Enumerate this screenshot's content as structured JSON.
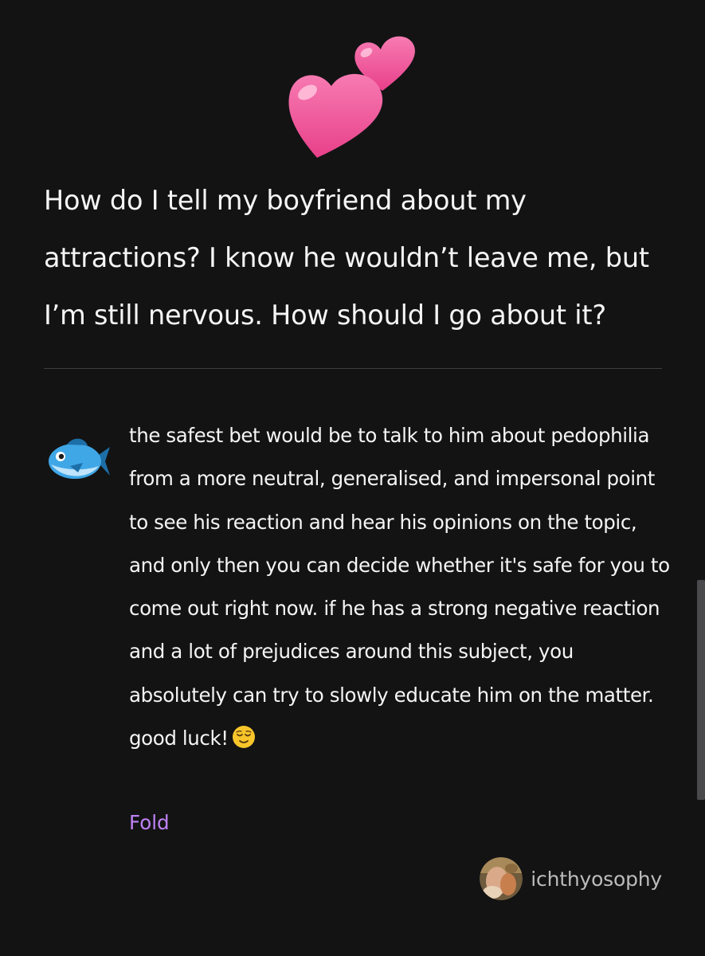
{
  "question": {
    "emoji": "two-hearts",
    "text": "How do I tell my boyfriend about my attractions? I know he wouldn’t leave me, but I’m still nervous. How should I go about it?"
  },
  "answer": {
    "avatar_icon": "fish-icon",
    "paragraph": "the safest bet would be to talk to him about pedophilia from a more neutral, generalised, and impersonal point to see his reaction and hear his opinions on the topic, and only then you can decide whether it's safe for you to come out right now. if he has a strong negative reaction and a lot of prejudices around this subject, you absolutely can try to slowly educate him on the matter.",
    "closing": "good luck!",
    "closing_emoji": "relieved-face",
    "fold_label": "Fold"
  },
  "author": {
    "name": "ichthyosophy"
  },
  "colors": {
    "background": "#131314",
    "text": "#f5f5f5",
    "link": "#c082f5",
    "muted": "#bcbcbc",
    "divider": "#3f3f42"
  }
}
